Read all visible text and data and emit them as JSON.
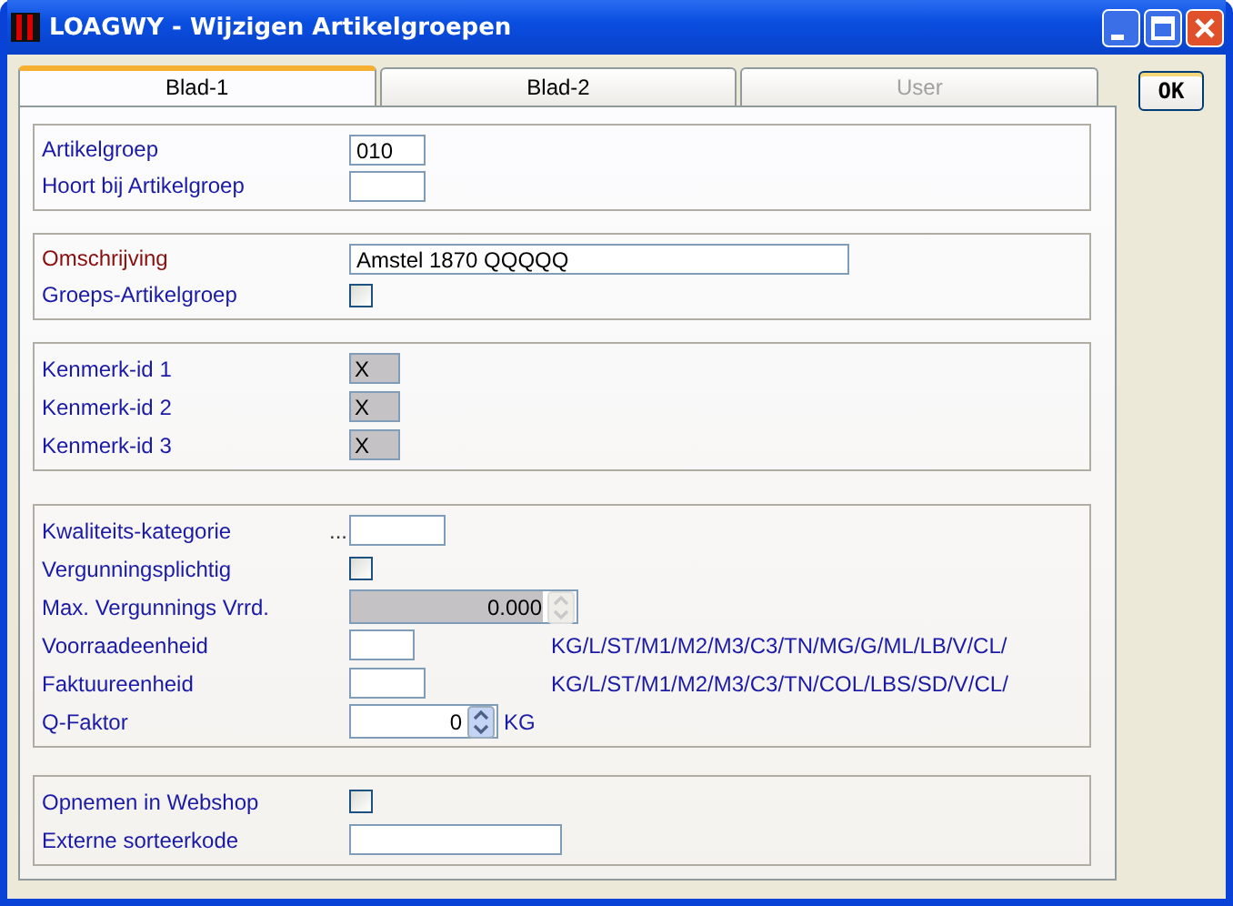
{
  "window": {
    "title": "LOAGWY - Wijzigen Artikelgroepen"
  },
  "tabs": [
    {
      "label": "Blad-1",
      "selected": true,
      "disabled": false
    },
    {
      "label": "Blad-2",
      "selected": false,
      "disabled": false
    },
    {
      "label": "User",
      "selected": false,
      "disabled": true
    }
  ],
  "ok_button": "OK",
  "groups": [
    {
      "rows": [
        {
          "kind": "text",
          "label": "Artikelgroep",
          "value": "010"
        },
        {
          "kind": "text",
          "label": "Hoort bij Artikelgroep"
        }
      ]
    },
    {
      "rows": [
        {
          "kind": "text",
          "label": "Omschrijving",
          "required": true,
          "value": "Amstel 1870  QQQQQ"
        },
        {
          "kind": "checkbox",
          "label": "Groeps-Artikelgroep",
          "checked": false
        }
      ]
    },
    {
      "rows": [
        {
          "kind": "readonly",
          "label": "Kenmerk-id 1",
          "value": "X"
        },
        {
          "kind": "readonly",
          "label": "Kenmerk-id 2",
          "value": "X"
        },
        {
          "kind": "readonly",
          "label": "Kenmerk-id 3",
          "value": "X"
        }
      ]
    },
    {
      "rows": [
        {
          "kind": "text",
          "label": "Kwaliteits-kategorie",
          "prefix": "..."
        },
        {
          "kind": "checkbox",
          "label": "Vergunningsplichtig",
          "checked": false
        },
        {
          "kind": "spinner",
          "label": "Max. Vergunnings Vrrd.",
          "value": "0.000",
          "disabled": true
        },
        {
          "kind": "text",
          "label": "Voorraadeenheid",
          "note": "KG/L/ST/M1/M2/M3/C3/TN/MG/G/ML/LB/V/CL/"
        },
        {
          "kind": "text",
          "label": "Faktuureenheid",
          "note": "KG/L/ST/M1/M2/M3/C3/TN/COL/LBS/SD/V/CL/"
        },
        {
          "kind": "spinner",
          "label": "Q-Faktor",
          "value": "0",
          "disabled": false,
          "unit": "KG"
        }
      ]
    },
    {
      "rows": [
        {
          "kind": "checkbox",
          "label": "Opnemen in Webshop",
          "checked": false
        },
        {
          "kind": "text",
          "label": "Externe sorteerkode"
        }
      ]
    }
  ]
}
